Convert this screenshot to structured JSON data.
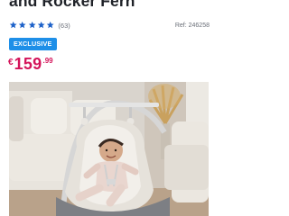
{
  "product": {
    "title": "and Rocker Fern",
    "rating": {
      "stars_filled": 5,
      "stars_total": 5,
      "review_count": "(63)"
    },
    "ref": "Ref: 246258",
    "badge": "EXCLUSIVE",
    "price": {
      "currency": "€",
      "whole": "159",
      "cents": ".99"
    },
    "image_subject": "baby-rocker-product-photo"
  },
  "colors": {
    "title": "#1f2228",
    "star": "#1c61c9",
    "badge_bg": "#1e8fe8",
    "price": "#d4145a",
    "muted_text": "#6a6f78"
  },
  "icons": {
    "star": "star-icon"
  }
}
